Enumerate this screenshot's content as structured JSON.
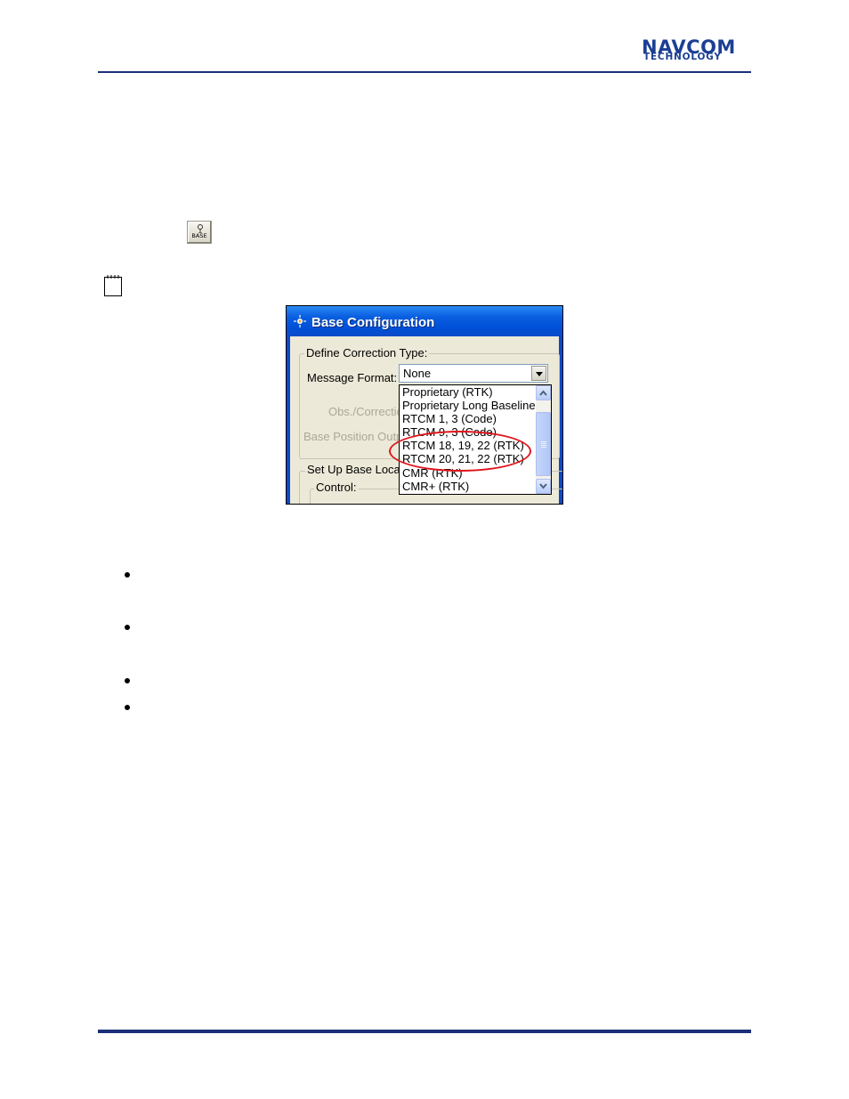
{
  "header": {
    "logo_line1": "NAVCOM",
    "logo_line2": "TECHNOLOGY"
  },
  "toolbar_icon": {
    "label": "BASE",
    "icon": "base-station-icon"
  },
  "note": {
    "icon": "note-icon"
  },
  "dialog": {
    "title": "Base Configuration",
    "define_correction_group": "Define Correction Type:",
    "message_format_label": "Message Format:",
    "message_format_value": "None",
    "obs_label_partial": "Obs./Correctio",
    "base_pos_label_partial": "Base Position Outp",
    "setup_group_partial": "Set Up Base Loca",
    "control_label": "Control:",
    "options": [
      "Proprietary (RTK)",
      "Proprietary Long Baseline",
      "RTCM 1, 3 (Code)",
      "RTCM 9, 3 (Code)",
      "RTCM 18, 19, 22 (RTK)",
      "RTCM 20, 21, 22 (RTK)",
      "CMR (RTK)",
      "CMR+ (RTK)"
    ],
    "highlighted_options": [
      "RTCM 18, 19, 22 (RTK)",
      "RTCM 20, 21, 22 (RTK)"
    ],
    "highlight_color": "#e0141b",
    "title_bar_color": "#0050d8"
  },
  "colors": {
    "brand": "#1c3f94",
    "rule": "#1c2f7a"
  },
  "bullets_count": 4
}
